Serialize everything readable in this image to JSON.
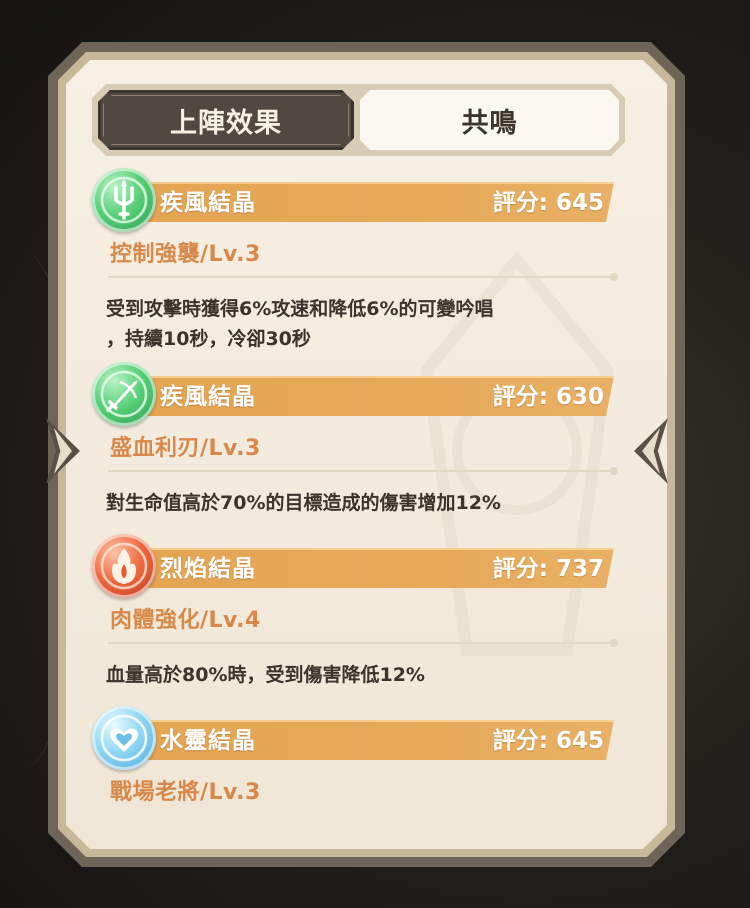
{
  "tabs": {
    "active_label": "上陣效果",
    "inactive_label": "共鳴"
  },
  "score_label": "評分:",
  "entries": [
    {
      "crystal": "疾風結晶",
      "score": "645",
      "skill": "控制強襲/Lv.3",
      "desc_line1": "受到攻擊時獲得6%攻速和降低6%的可變吟唱",
      "desc_line2": "，持續10秒，冷卻30秒",
      "icon": "trident-gem-icon",
      "color": "green"
    },
    {
      "crystal": "疾風結晶",
      "score": "630",
      "skill": "盛血利刃/Lv.3",
      "desc_line1": "對生命值高於70%的目標造成的傷害增加12%",
      "icon": "blade-gem-icon",
      "color": "green"
    },
    {
      "crystal": "烈焰結晶",
      "score": "737",
      "skill": "肉體強化/Lv.4",
      "desc_line1": "血量高於80%時，受到傷害降低12%",
      "icon": "flame-gem-icon",
      "color": "red"
    },
    {
      "crystal": "水靈結晶",
      "score": "645",
      "skill": "戰場老將/Lv.3",
      "icon": "heart-shield-gem-icon",
      "color": "blue"
    }
  ],
  "colors": {
    "bar": "#e3a552",
    "skill_text": "#d8894a",
    "panel": "#f4ecdf",
    "frame": "#6e6458",
    "active_tab": "#514941"
  }
}
